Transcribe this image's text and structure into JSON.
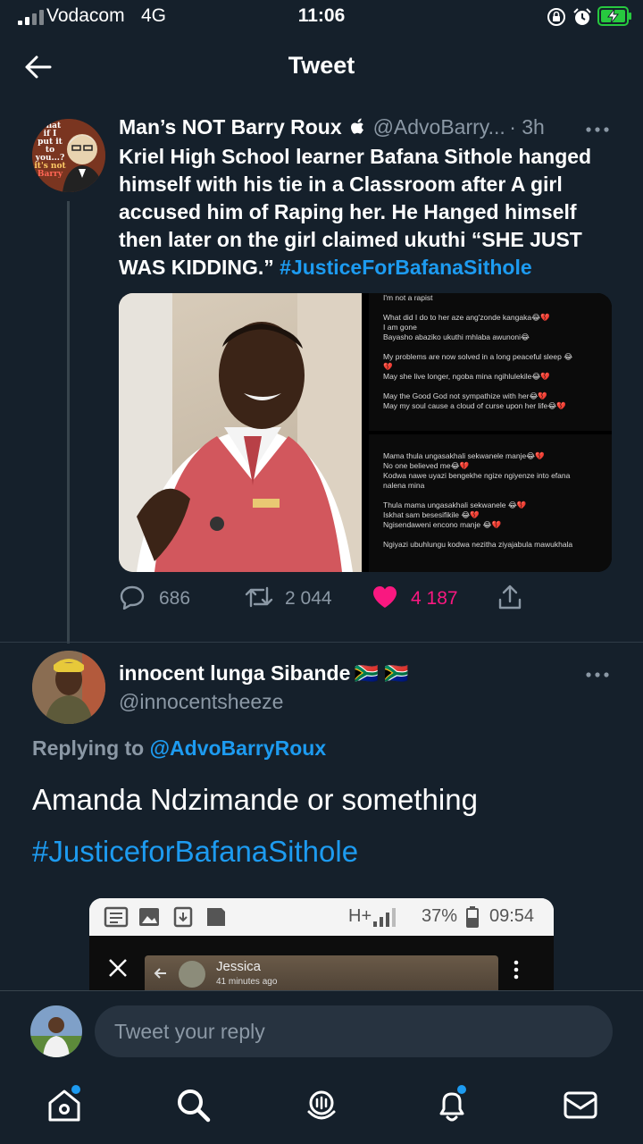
{
  "status_bar": {
    "carrier": "Vodacom",
    "network": "4G",
    "time": "11:06"
  },
  "header": {
    "title": "Tweet"
  },
  "tweet": {
    "author_name": "Man’s NOT Barry Roux",
    "author_handle": "@AdvoBarry...",
    "time_ago": "· 3h",
    "text": "Kriel High School learner Bafana Sithole hanged himself with his tie in a Classroom after A girl accused him of Raping her. He Hanged himself then later on the girl claimed ukuthi “SHE JUST WAS KIDDING.” ",
    "hashtag": "#JusticeForBafanaSithole",
    "avatar_caption": [
      "what",
      "if I",
      "put it",
      "to you...?",
      "it's not",
      "Barry"
    ],
    "media_chat_top": [
      "I'm not a rapist",
      "",
      "What did I do to her aze ang'zonde kangaka😂💔",
      "I am gone",
      "Bayasho abaziko ukuthi mhlaba awunoni😂",
      "",
      "My problems are now solved in a long peaceful sleep 😂",
      "💔",
      "May she live longer, ngoba mina ngihlulekile😂💔",
      "",
      "May the Good God not sympathize with her😂💔",
      "May my soul cause a cloud of curse upon her life😂💔"
    ],
    "media_chat_bottom": [
      "",
      "Mama thula ungasakhali sekwanele manje😂💔",
      "No one believed me😂💔",
      "Kodwa nawe uyazi bengekhe ngize ngiyenze into efana",
      "nalena mina",
      "",
      "Thula mama ungasakhali sekwanele 😂💔",
      "Iskhat sam besesifikile 😂💔",
      "Ngisendaweni encono manje 😂💔",
      "",
      "Ngiyazi ubuhlungu kodwa nezitha ziyajabula mawukhala"
    ],
    "replies": "686",
    "retweets": "2 044",
    "likes": "4 187"
  },
  "reply": {
    "author_name": "innocent lunga Sibande",
    "flags": "🇿🇦 🇿🇦",
    "author_handle": "@innocentsheeze",
    "replying_prefix": "Replying to ",
    "replying_to": "@AdvoBarryRoux",
    "text": "Amanda Ndzimande or something",
    "hashtag": "#JusticeforBafanaSithole",
    "embedded_screenshot": {
      "network": "H+",
      "battery": "37%",
      "time": "09:54",
      "contact": "Jessica",
      "contact_time": "41 minutes ago"
    }
  },
  "composer": {
    "placeholder": "Tweet your reply"
  },
  "colors": {
    "background": "#15202b",
    "accent": "#1d9bf0",
    "like": "#f91880",
    "muted": "#8b98a5",
    "battery": "#27c93f"
  }
}
